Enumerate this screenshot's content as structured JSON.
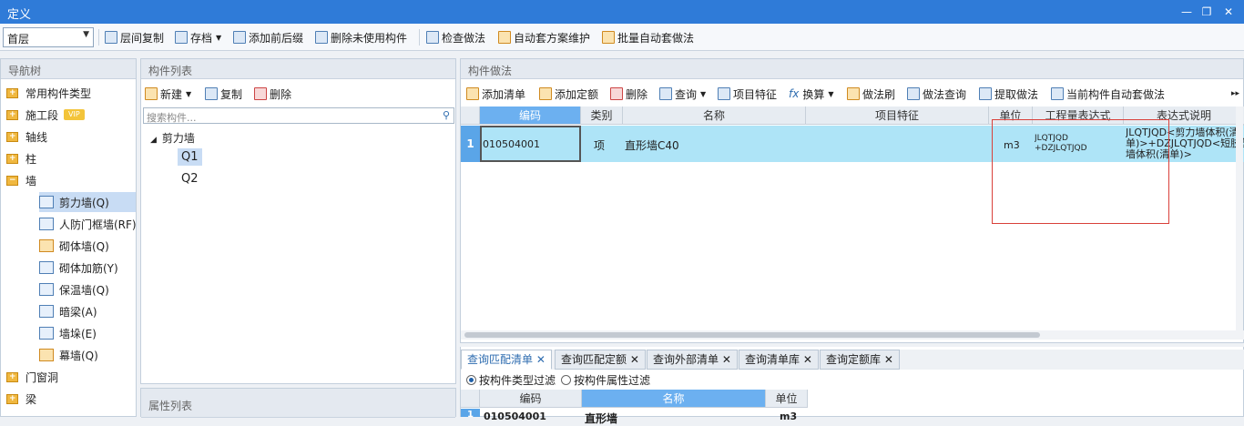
{
  "window": {
    "title": "定义"
  },
  "toolbar": {
    "floor": "首层",
    "items": [
      {
        "label": "层间复制"
      },
      {
        "label": "存档"
      },
      {
        "label": "添加前后缀"
      },
      {
        "label": "删除未使用构件"
      },
      {
        "label": "检查做法"
      },
      {
        "label": "自动套方案维护"
      },
      {
        "label": "批量自动套做法"
      }
    ]
  },
  "nav": {
    "title": "导航树",
    "vip": "VIP",
    "items": [
      {
        "label": "常用构件类型"
      },
      {
        "label": "施工段"
      },
      {
        "label": "轴线"
      },
      {
        "label": "柱"
      },
      {
        "label": "墙"
      }
    ],
    "wall_children": [
      {
        "label": "剪力墙(Q)"
      },
      {
        "label": "人防门框墙(RF)"
      },
      {
        "label": "砌体墙(Q)"
      },
      {
        "label": "砌体加筋(Y)"
      },
      {
        "label": "保温墙(Q)"
      },
      {
        "label": "暗梁(A)"
      },
      {
        "label": "墙垛(E)"
      },
      {
        "label": "幕墙(Q)"
      }
    ],
    "after": [
      {
        "label": "门窗洞"
      },
      {
        "label": "梁"
      }
    ]
  },
  "component_list": {
    "title": "构件列表",
    "new": "新建",
    "copy": "复制",
    "delete": "删除",
    "search_placeholder": "搜索构件...",
    "tree_root": "剪力墙",
    "children": [
      "Q1",
      "Q2"
    ]
  },
  "property_list": {
    "title": "属性列表"
  },
  "method": {
    "title": "构件做法",
    "toolbar": [
      "添加清单",
      "添加定额",
      "删除",
      "查询",
      "项目特征",
      "换算",
      "做法刷",
      "做法查询",
      "提取做法",
      "当前构件自动套做法"
    ],
    "columns": [
      "编码",
      "类别",
      "名称",
      "项目特征",
      "单位",
      "工程量表达式",
      "表达式说明"
    ],
    "rows": [
      {
        "index": "1",
        "code": "010504001",
        "type": "项",
        "name": "直形墙C40",
        "feature": "",
        "unit": "m3",
        "expr1": "JLQTJQD",
        "expr2": "+DZJLQTJQD",
        "desc1": "JLQTJQD<剪力墙体积(清",
        "desc2": "单)>+DZJLQTJQD<短肢剪力",
        "desc3": "墙体积(清单)>"
      }
    ]
  },
  "bottom": {
    "tabs": [
      "查询匹配清单",
      "查询匹配定额",
      "查询外部清单",
      "查询清单库",
      "查询定额库"
    ],
    "filter1": "按构件类型过滤",
    "filter2": "按构件属性过滤",
    "columns": [
      "编码",
      "名称",
      "单位"
    ],
    "row": {
      "index": "1",
      "code": "010504001",
      "name": "直形墙",
      "unit": "m3"
    }
  },
  "colors": {
    "titlebar": "#2f7bd8",
    "row_highlight": "#aee4f7",
    "header_blue": "#6cb0f0",
    "red_box": "#d9403a"
  }
}
